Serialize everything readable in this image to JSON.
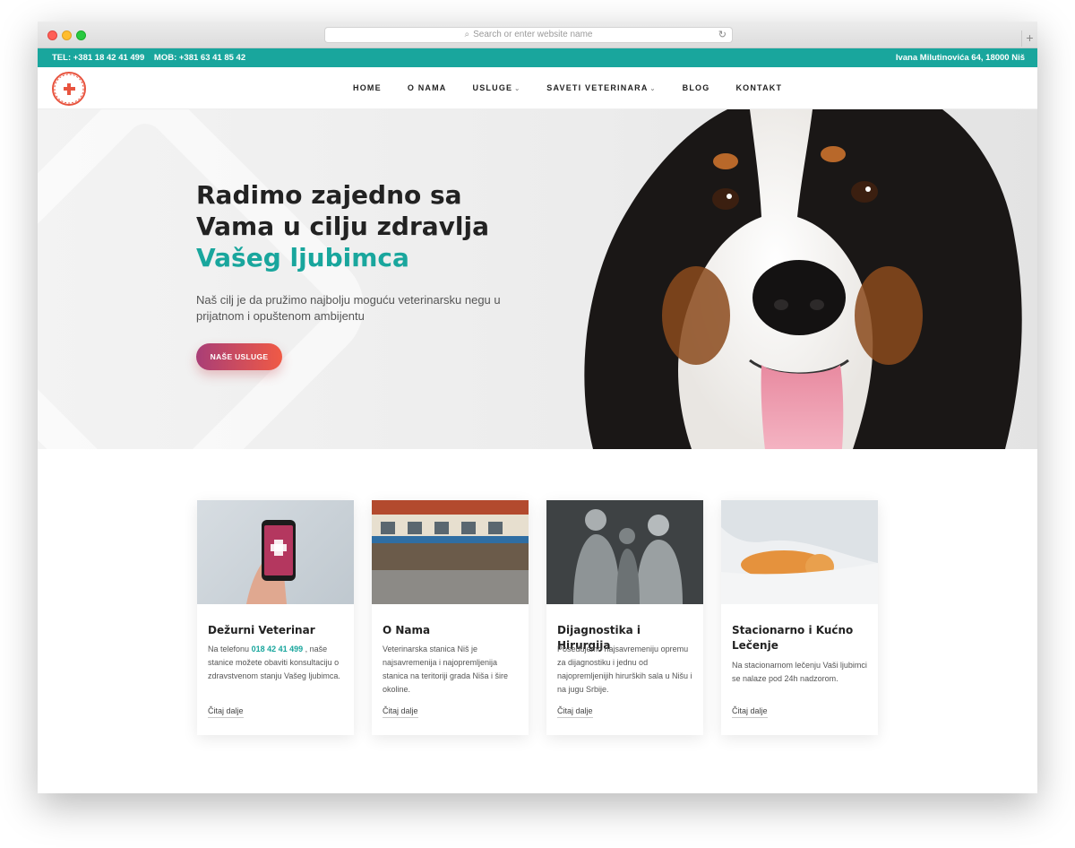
{
  "browser": {
    "url_placeholder": "Search or enter website name"
  },
  "topbar": {
    "tel": "TEL: +381 18 42 41 499",
    "mob": "MOB: +381 63 41 85 42",
    "address": "Ivana Milutinovića 64, 18000 Niš"
  },
  "logo": {
    "text": "VETERINARSKA STANICA NIŠ"
  },
  "nav": {
    "items": [
      {
        "label": "HOME"
      },
      {
        "label": "O NAMA"
      },
      {
        "label": "USLUGE"
      },
      {
        "label": "SAVETI VETERINARA"
      },
      {
        "label": "BLOG"
      },
      {
        "label": "KONTAKT"
      }
    ]
  },
  "hero": {
    "title_line1": "Radimo zajedno sa",
    "title_line2": "Vama u cilju zdravlja",
    "title_accent": "Vašeg ljubimca",
    "subtitle": "Naš cilj je da pružimo najbolju moguću veterinarsku negu u prijatnom i opuštenom ambijentu",
    "cta": "NAŠE USLUGE"
  },
  "cards": [
    {
      "title": "Dežurni Veterinar",
      "text_before": "Na telefonu",
      "phone": "018 42 41 499",
      "text_after": ", naše stanice možete obaviti konsultaciju o zdravstvenom stanju Vašeg ljubimca.",
      "more": "Čitaj dalje"
    },
    {
      "title": "O Nama",
      "text": "Veterinarska stanica Niš je najsavremenija i najopremljenija stanica na teritoriji grada Niša i šire okoline.",
      "more": "Čitaj dalje"
    },
    {
      "title": "Dijagnostika i Hirurgija",
      "text": "Posedujemo najsavremeniju opremu za dijagnostiku i jednu od najopremljenijih hirurških sala u Nišu i na jugu Srbije.",
      "more": "Čitaj dalje"
    },
    {
      "title": "Stacionarno i Kućno Lečenje",
      "text": "Na stacionarnom lečenju Vaši ljubimci se nalaze pod 24h nadzorom.",
      "more": "Čitaj dalje"
    }
  ],
  "colors": {
    "accent": "#19a69d",
    "cta_start": "#a93e77",
    "cta_end": "#f05a45",
    "logo": "#e8543f"
  }
}
